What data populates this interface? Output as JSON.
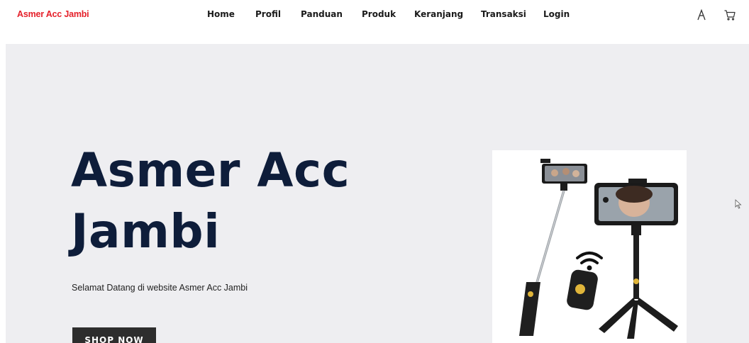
{
  "brand": {
    "name": "Asmer Acc Jambi"
  },
  "nav": {
    "items": [
      {
        "label": "Home"
      },
      {
        "label": "Profil"
      },
      {
        "label": "Panduan"
      },
      {
        "label": "Produk"
      },
      {
        "label": "Keranjang"
      },
      {
        "label": "Transaksi"
      },
      {
        "label": "Login"
      }
    ],
    "icons": [
      "user-icon",
      "cart-icon"
    ]
  },
  "hero": {
    "title": "Asmer Acc Jambi",
    "subtitle": "Selamat Datang di website Asmer Acc Jambi",
    "button_label": "SHOP NOW",
    "image": "selfie-stick-tripod-product-image"
  },
  "colors": {
    "brand": "#e5202a",
    "title": "#0e1d3a",
    "hero_bg": "#eeeef1",
    "button_bg": "#2d2d2d"
  }
}
